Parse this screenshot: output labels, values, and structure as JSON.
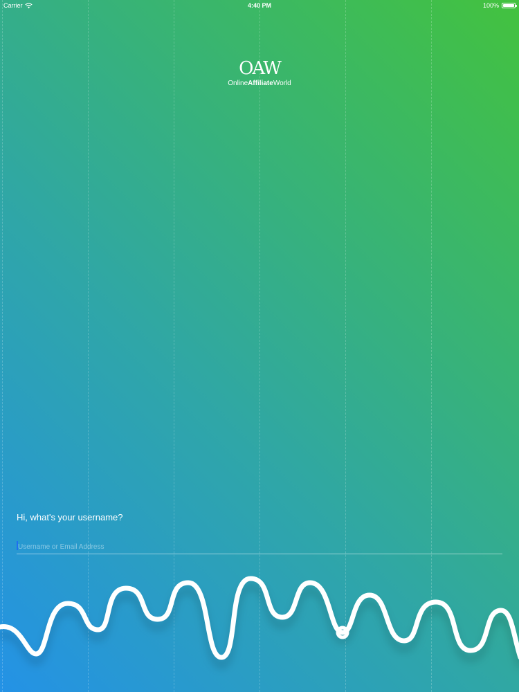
{
  "status_bar": {
    "carrier": "Carrier",
    "time": "4:40 PM",
    "battery": "100%",
    "battery_level": 1.0
  },
  "logo": {
    "mark": "OAW",
    "word_prefix": "Online",
    "word_bold": "Affiliate",
    "word_suffix": "World"
  },
  "login": {
    "prompt": "Hi, what's your username?",
    "username_placeholder": "Username or Email Address",
    "username_value": ""
  },
  "colors": {
    "gradient_start": "#2492e6",
    "gradient_end": "#43c23e",
    "wave": "#ffffff",
    "caret": "#1f6ff0"
  },
  "icons": [
    "wifi-icon",
    "battery-icon",
    "progress-marker-icon"
  ]
}
